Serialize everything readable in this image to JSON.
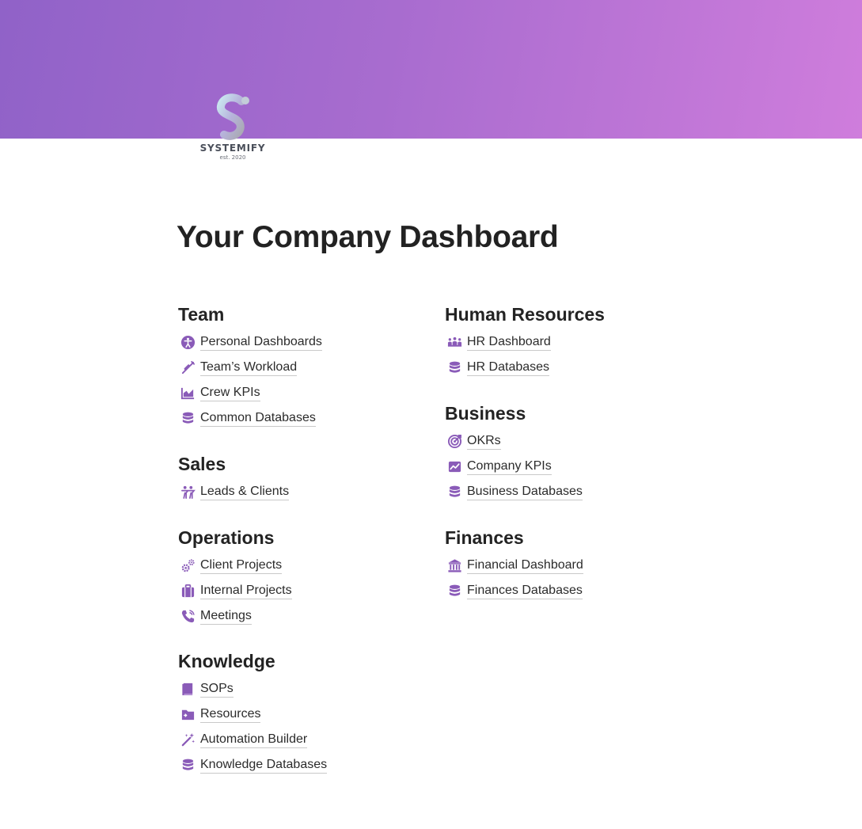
{
  "brand": {
    "name": "SYSTEMIFY",
    "tagline": "est. 2020",
    "accent_color": "#8a5bb8",
    "cover_gradient": [
      "#9062c8",
      "#cf7ddc"
    ]
  },
  "page": {
    "title": "Your Company Dashboard"
  },
  "sections": {
    "team": {
      "title": "Team",
      "links": [
        {
          "label": "Personal Dashboards",
          "icon": "accessibility-icon"
        },
        {
          "label": "Team’s Workload",
          "icon": "syringe-icon"
        },
        {
          "label": "Crew KPIs",
          "icon": "area-chart-icon"
        },
        {
          "label": "Common Databases",
          "icon": "database-icon"
        }
      ]
    },
    "sales": {
      "title": "Sales",
      "links": [
        {
          "label": "Leads & Clients",
          "icon": "people-icon"
        }
      ]
    },
    "operations": {
      "title": "Operations",
      "links": [
        {
          "label": "Client Projects",
          "icon": "gears-icon"
        },
        {
          "label": "Internal Projects",
          "icon": "briefcase-icon"
        },
        {
          "label": "Meetings",
          "icon": "phone-icon"
        }
      ]
    },
    "knowledge": {
      "title": "Knowledge",
      "links": [
        {
          "label": "SOPs",
          "icon": "book-icon"
        },
        {
          "label": "Resources",
          "icon": "folder-icon"
        },
        {
          "label": "Automation Builder",
          "icon": "magic-wand-icon"
        },
        {
          "label": "Knowledge Databases",
          "icon": "database-icon"
        }
      ]
    },
    "human_resources": {
      "title": "Human Resources",
      "links": [
        {
          "label": "HR Dashboard",
          "icon": "group-icon"
        },
        {
          "label": "HR Databases",
          "icon": "database-icon"
        }
      ]
    },
    "business": {
      "title": "Business",
      "links": [
        {
          "label": "OKRs",
          "icon": "target-icon"
        },
        {
          "label": "Company KPIs",
          "icon": "line-chart-icon"
        },
        {
          "label": "Business Databases",
          "icon": "database-icon"
        }
      ]
    },
    "finances": {
      "title": "Finances",
      "links": [
        {
          "label": "Financial Dashboard",
          "icon": "bank-icon"
        },
        {
          "label": "Finances Databases",
          "icon": "database-icon"
        }
      ]
    }
  }
}
